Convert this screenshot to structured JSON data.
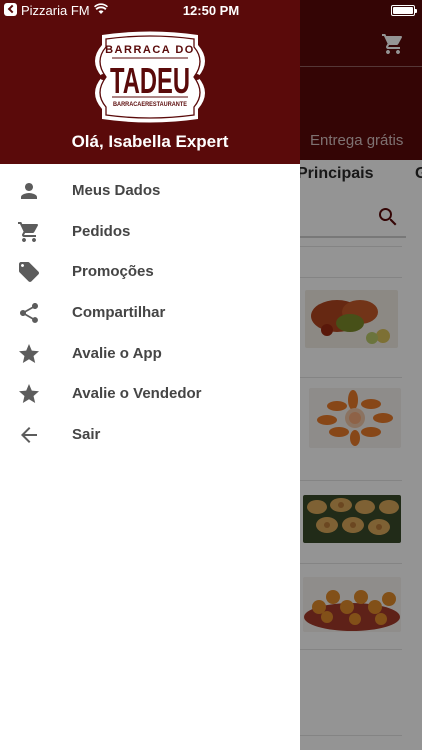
{
  "status_bar": {
    "carrier": "Pizzaria FM",
    "time": "12:50 PM"
  },
  "drawer": {
    "logo": {
      "top_text": "BARRACA DO",
      "main_text": "TADEU",
      "bottom_text": "BARRACAERESTAURANTE"
    },
    "greeting": "Olá, Isabella Expert",
    "menu": [
      {
        "label": "Meus Dados",
        "icon": "person-icon"
      },
      {
        "label": "Pedidos",
        "icon": "cart-icon"
      },
      {
        "label": "Promoções",
        "icon": "tag-icon"
      },
      {
        "label": "Compartilhar",
        "icon": "share-icon"
      },
      {
        "label": "Avalie o App",
        "icon": "star-icon"
      },
      {
        "label": "Avalie o Vendedor",
        "icon": "star-icon"
      },
      {
        "label": "Sair",
        "icon": "arrow-back-icon"
      }
    ]
  },
  "background": {
    "delivery_text": "Entrega grátis",
    "tabs": [
      "Principais",
      "G"
    ]
  },
  "colors": {
    "brand": "#5a0a0a",
    "icon": "#5c5c5c",
    "text": "#454545"
  }
}
